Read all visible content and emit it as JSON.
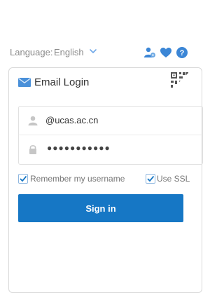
{
  "header": {
    "language_label": "Language:",
    "language_value": "English",
    "icons": [
      "user-switch-icon",
      "heart-icon",
      "help-icon"
    ]
  },
  "login": {
    "title": "Email Login",
    "username_value": "@ucas.ac.cn",
    "password_mask": "●●●●●●●●●●●",
    "remember_label": "Remember my username",
    "remember_checked": true,
    "ssl_label": "Use SSL",
    "ssl_checked": true,
    "signin_label": "Sign in"
  },
  "colors": {
    "accent": "#1677c5",
    "icon_blue": "#3b86d6"
  }
}
